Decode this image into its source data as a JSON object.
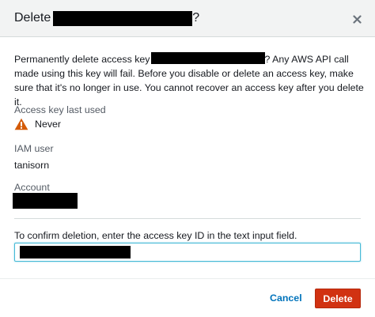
{
  "dialog": {
    "title_prefix": "Delete",
    "title_suffix": "?",
    "close_symbol": "×",
    "body_prefix": "Permanently delete access key",
    "body_suffix": "? Any AWS API call made using this key will fail. Before you disable or delete an access key, make sure that it's no longer in use. You cannot recover an access key after you delete it."
  },
  "fields": {
    "last_used_label": "Access key last used",
    "last_used_value": "Never",
    "iam_user_label": "IAM user",
    "iam_user_value": "tanisorn",
    "account_label": "Account"
  },
  "confirm": {
    "label": "To confirm deletion, enter the access key ID in the text input field."
  },
  "footer": {
    "cancel_label": "Cancel",
    "delete_label": "Delete"
  },
  "colors": {
    "header_bg": "#f2f3f3",
    "warning": "#d45b07",
    "link": "#0073bb",
    "danger": "#d13212",
    "focus_border": "#44b9d6"
  },
  "icons": {
    "warning": "warning-icon",
    "close": "close-icon"
  }
}
